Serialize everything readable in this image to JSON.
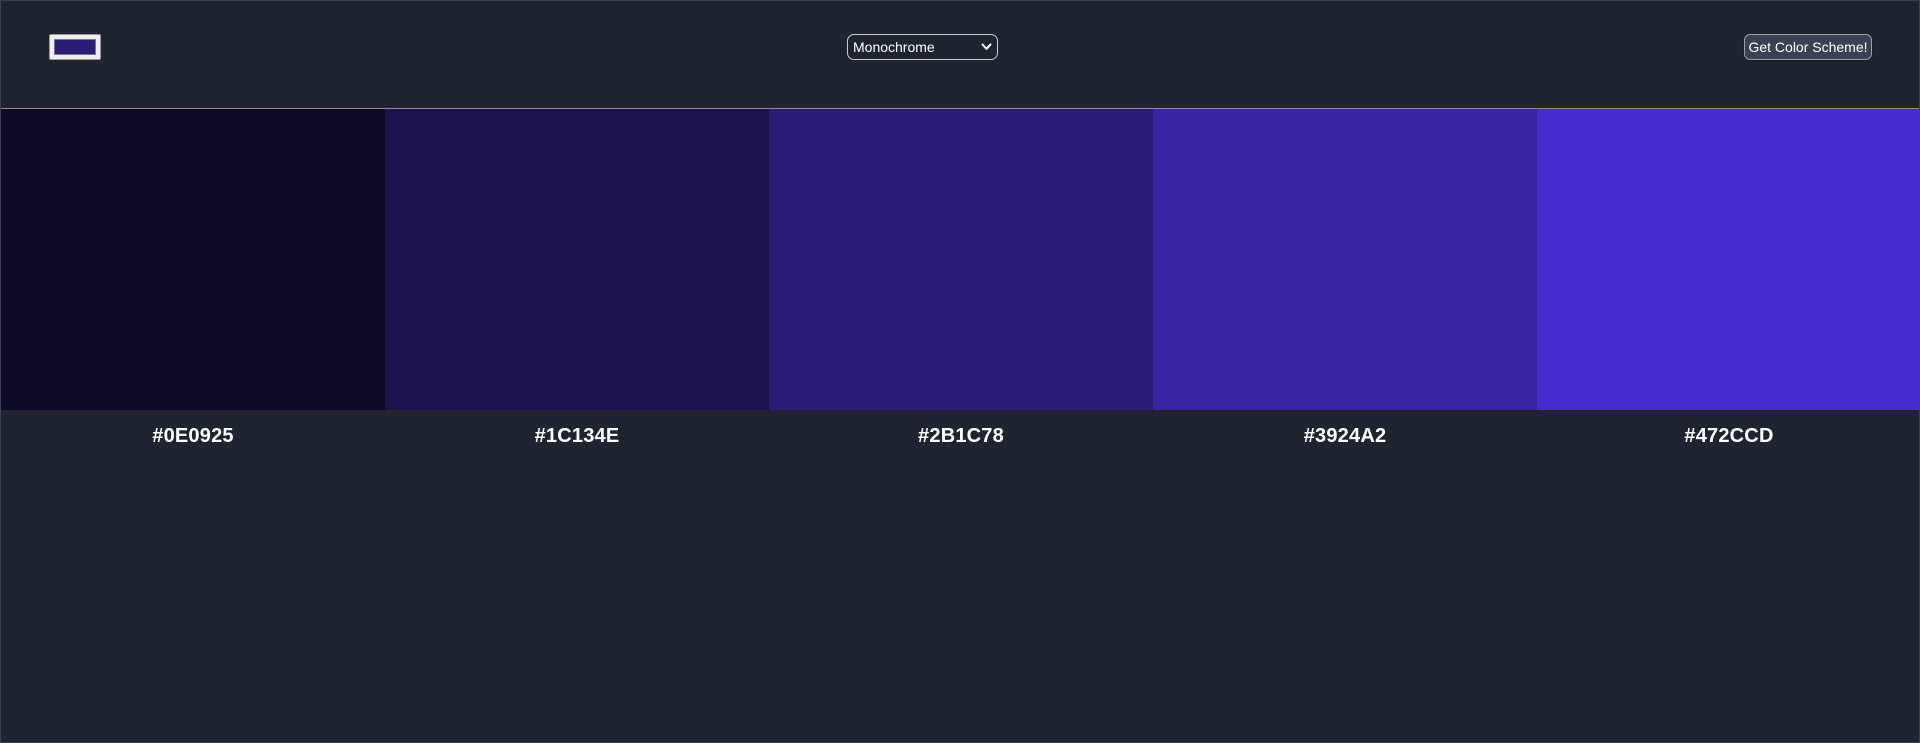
{
  "header": {
    "seed_color": "#2B1C78",
    "mode_select": {
      "selected": "Monochrome",
      "chevron_icon": "chevron-down-icon"
    },
    "get_scheme_label": "Get Color Scheme!"
  },
  "scheme": {
    "colors": [
      {
        "hex": "#0E0925"
      },
      {
        "hex": "#1C134E"
      },
      {
        "hex": "#2B1C78"
      },
      {
        "hex": "#3924A2"
      },
      {
        "hex": "#472CCD"
      }
    ]
  }
}
